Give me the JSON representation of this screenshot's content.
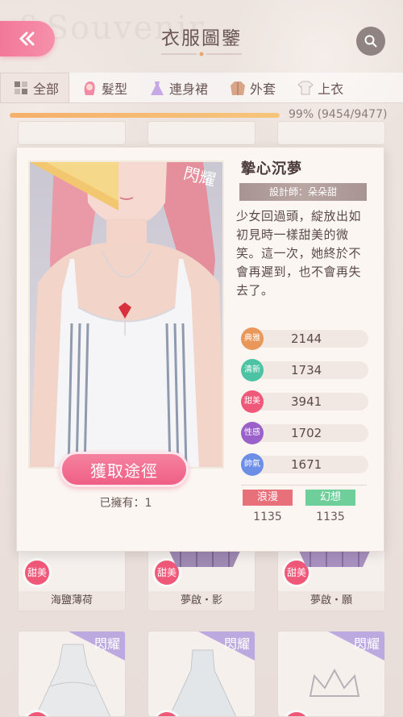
{
  "header": {
    "title": "衣服圖鑒",
    "bg_watermark": "&Souvenir"
  },
  "tabs": [
    {
      "label": "全部",
      "icon": "grid-icon"
    },
    {
      "label": "髮型",
      "icon": "hair-icon"
    },
    {
      "label": "連身裙",
      "icon": "dress-icon"
    },
    {
      "label": "外套",
      "icon": "coat-icon"
    },
    {
      "label": "上衣",
      "icon": "top-icon"
    }
  ],
  "progress": {
    "fraction": 0.99,
    "text": "99% (9454/9477)"
  },
  "grid": {
    "row1": [
      {
        "name": "甜美",
        "label": "海鹽薄荷"
      },
      {
        "name": "甜美",
        "label": "夢啟・影"
      },
      {
        "name": "甜美",
        "label": "夢啟・願"
      }
    ],
    "badge_label": "甜美",
    "flash_label": "閃耀"
  },
  "popup": {
    "item_name": "摯心沉夢",
    "designer": "設計師：朵朵甜",
    "description": "少女回過頭，綻放出如初見時一樣甜美的微笑。這一次，她終於不會再遲到，也不會再失去了。",
    "flash_badge": "閃耀",
    "get_button": "獲取途徑",
    "owned": "已擁有：1",
    "stats": [
      {
        "name": "典雅",
        "value": "2144",
        "color": "#e9975a"
      },
      {
        "name": "清新",
        "value": "1734",
        "color": "#4cc4a4"
      },
      {
        "name": "甜美",
        "value": "3941",
        "color": "#f0587a"
      },
      {
        "name": "性感",
        "value": "1702",
        "color": "#9a62c8"
      },
      {
        "name": "帥氣",
        "value": "1671",
        "color": "#6c8ee6"
      }
    ],
    "tags": [
      {
        "label": "浪漫",
        "value": "1135",
        "color": "#e8707a"
      },
      {
        "label": "幻想",
        "value": "1135",
        "color": "#6fcf9b"
      }
    ]
  }
}
